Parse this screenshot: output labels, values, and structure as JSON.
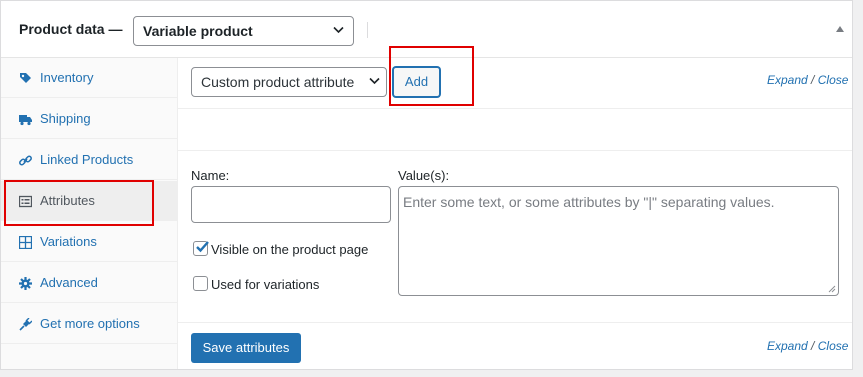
{
  "header": {
    "title": "Product data —",
    "product_type": "Variable product"
  },
  "tabs": [
    {
      "label": "Inventory",
      "icon": "tag-icon"
    },
    {
      "label": "Shipping",
      "icon": "truck-icon"
    },
    {
      "label": "Linked Products",
      "icon": "link-icon"
    },
    {
      "label": "Attributes",
      "icon": "list-icon",
      "active": true
    },
    {
      "label": "Variations",
      "icon": "grid-icon"
    },
    {
      "label": "Advanced",
      "icon": "gear-icon"
    },
    {
      "label": "Get more options",
      "icon": "plugin-icon"
    }
  ],
  "toolbar": {
    "attribute_select": "Custom product attribute",
    "add_label": "Add",
    "expand_label": "Expand",
    "close_label": "Close",
    "separator": "/"
  },
  "form": {
    "name_label": "Name:",
    "name_value": "",
    "values_label": "Value(s):",
    "values_placeholder": "Enter some text, or some attributes by \"|\" separating values.",
    "visible_label": "Visible on the product page",
    "visible_checked": true,
    "variations_label": "Used for variations",
    "variations_checked": false
  },
  "footer": {
    "save_label": "Save attributes",
    "expand_label": "Expand",
    "close_label": "Close",
    "separator": "/"
  },
  "colors": {
    "accent": "#2271b1",
    "highlight": "#e00000"
  }
}
